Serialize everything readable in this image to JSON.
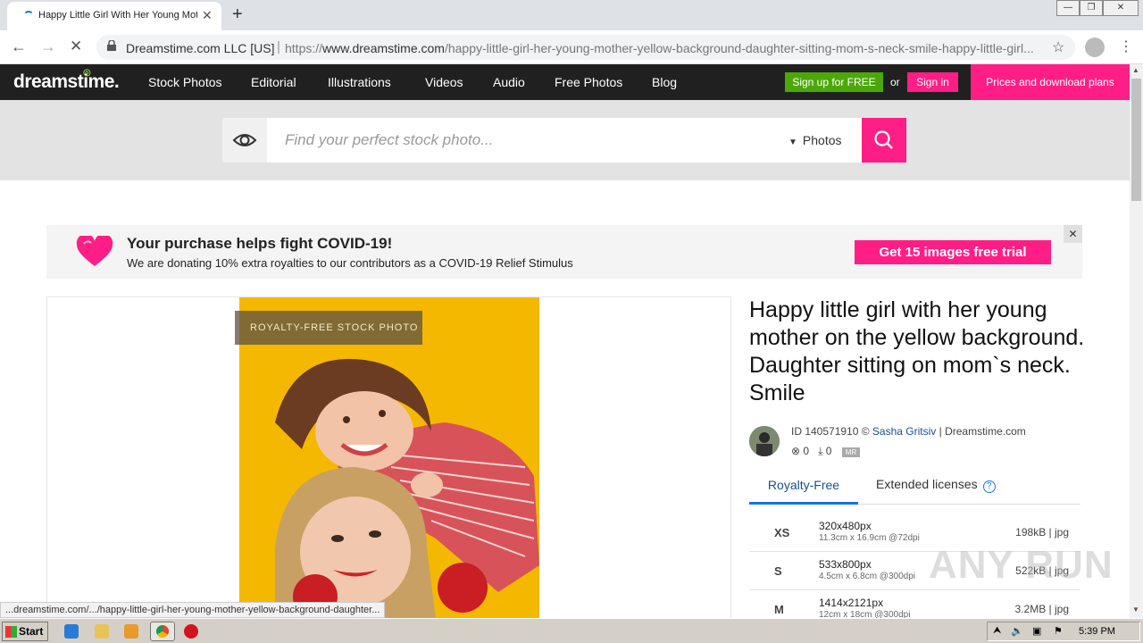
{
  "browser": {
    "tab_title": "Happy Little Girl With Her Young Mot",
    "site_org": "Dreamstime.com LLC [US]",
    "url_prefix": "https://",
    "url_host": "www.dreamstime.com",
    "url_path": "/happy-little-girl-her-young-mother-yellow-background-daughter-sitting-mom-s-neck-smile-happy-little-girl...",
    "status_url": "...dreamstime.com/.../happy-little-girl-her-young-mother-yellow-background-daughter..."
  },
  "site": {
    "logo": "dreamstime.",
    "nav": [
      "Stock Photos",
      "Editorial",
      "Illustrations",
      "Videos",
      "Audio",
      "Free Photos",
      "Blog"
    ],
    "signup_label": "Sign up for FREE",
    "or_label": "or",
    "signin_label": "Sign in",
    "prices_label": "Prices and download plans"
  },
  "search": {
    "placeholder": "Find your perfect stock photo...",
    "type_selected": "Photos"
  },
  "banner": {
    "headline": "Your purchase helps fight COVID-19!",
    "subline": "We are donating 10% extra royalties to our contributors as a COVID-19 Relief Stimulus",
    "cta": "Get 15 images free trial",
    "close": "✕"
  },
  "photo": {
    "label": "ROYALTY-FREE STOCK PHOTO",
    "title": "Happy little girl with her young mother on the yellow background. Daughter sitting on mom`s neck. Smile",
    "id_text": "ID 140571910 ©",
    "author": "Sasha Gritsiv",
    "site_suffix": "| Dreamstime.com",
    "favorites": "0",
    "downloads": "0",
    "mr_badge": "MR"
  },
  "license_tabs": {
    "royalty_free": "Royalty-Free",
    "extended": "Extended licenses",
    "help": "?"
  },
  "sizes": [
    {
      "code": "XS",
      "px": "320x480px",
      "dim": "11.3cm x 16.9cm @72dpi",
      "file": "198kB | jpg"
    },
    {
      "code": "S",
      "px": "533x800px",
      "dim": "4.5cm x 6.8cm @300dpi",
      "file": "522kB | jpg"
    },
    {
      "code": "M",
      "px": "1414x2121px",
      "dim": "12cm x 18cm @300dpi",
      "file": "3.2MB | jpg"
    }
  ],
  "watermark": "ANY RUN",
  "taskbar": {
    "start": "Start",
    "clock": "5:39 PM"
  },
  "colors": {
    "brand_pink": "#ff1e85",
    "signup_green": "#4ca80a",
    "nav_bg": "#202020",
    "photo_bg": "#f5b800"
  }
}
